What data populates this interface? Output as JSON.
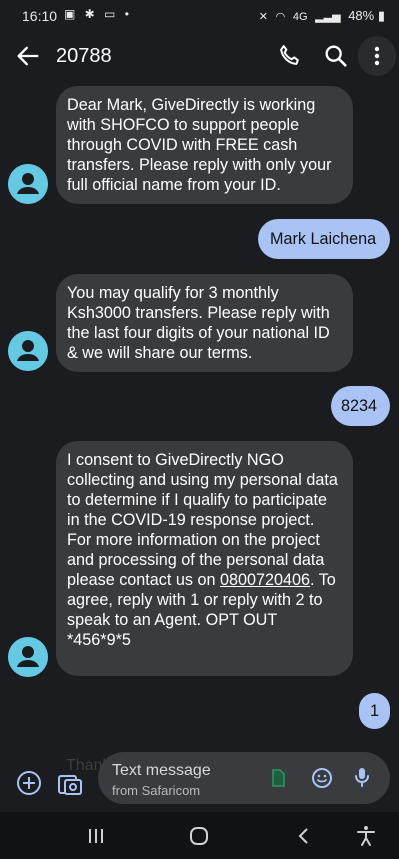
{
  "status_bar": {
    "time": "16:10",
    "left_icons": "▣ ✱ ▭ •",
    "network": "4G",
    "battery": "48%"
  },
  "header": {
    "title": "20788"
  },
  "messages": [
    {
      "dir": "in",
      "text": "Dear Mark, GiveDirectly is working with SHOFCO to support people through COVID with FREE cash transfers. Please reply with only your full official name from your ID."
    },
    {
      "dir": "out",
      "text": "Mark Laichena"
    },
    {
      "dir": "in",
      "text": "You may qualify for 3 monthly Ksh3000 transfers. Please reply with the last four digits of your national ID & we will share our terms."
    },
    {
      "dir": "out",
      "text": "8234"
    },
    {
      "dir": "in",
      "text_a": "I consent to GiveDirectly NGO collecting and using my personal data to determine if I qualify to participate in the COVID-19 response project. For more information on the project and processing of the personal data please contact us on ",
      "phone": "0800720406",
      "text_b": ". To agree, reply with 1 or reply with 2 to speak to an Agent. OPT OUT *456*9*5"
    },
    {
      "dir": "out",
      "text": "1"
    }
  ],
  "faint_preview": "Thank",
  "composer": {
    "placeholder": "Text message",
    "sub": "from Safaricom"
  },
  "icons": [
    "back-arrow-icon",
    "phone-icon",
    "search-icon",
    "more-vert-icon",
    "person-icon",
    "plus-icon",
    "gallery-icon",
    "sim-icon",
    "emoji-icon",
    "mic-icon",
    "recents-icon",
    "home-icon",
    "nav-back-icon",
    "accessibility-icon"
  ]
}
